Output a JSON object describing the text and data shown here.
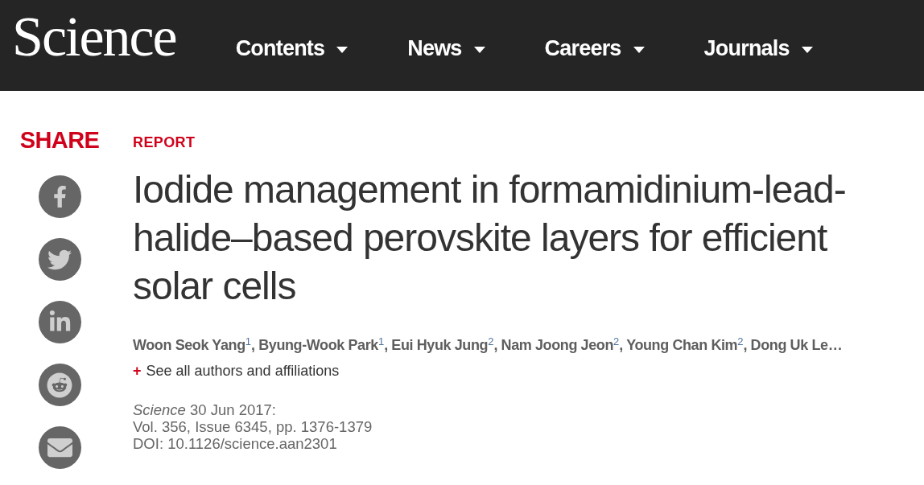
{
  "header": {
    "logo": "Science",
    "nav": [
      {
        "label": "Contents"
      },
      {
        "label": "News"
      },
      {
        "label": "Careers"
      },
      {
        "label": "Journals"
      }
    ]
  },
  "share": {
    "label": "SHARE"
  },
  "article": {
    "section": "REPORT",
    "title": "Iodide management in formamidinium-lead-halide–based perovskite layers for efficient solar cells",
    "authors": "Woon Seok Yang$^{1}$, Byung-Wook Park$^{1}$, Eui Hyuk Jung$^{2}$, Nam Joong Jeon$^{2}$, Young Chan Kim$^{2}$, Dong Uk Le…",
    "authors_link": {
      "icon": "+",
      "label": "See all authors and affiliations"
    },
    "citation": [
      "*Science* 30 Jun 2017:",
      "Vol. 356, Issue 6345, pp. 1376-1379",
      "DOI: 10.1126/science.aan2301"
    ]
  }
}
